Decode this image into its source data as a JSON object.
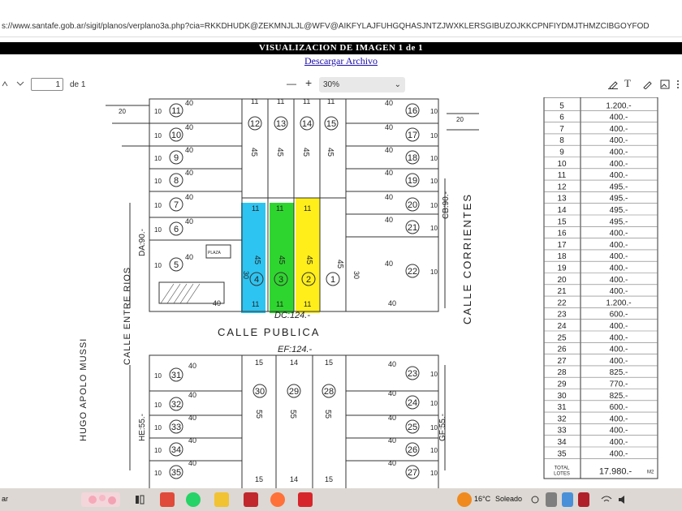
{
  "browser": {
    "url": "s://www.santafe.gob.ar/sigit/planos/verplano3a.php?cia=RKKDHUDK@ZEKMNJLJL@WFV@AIKFYLAJFUHGQHASJNTZJWXKLERSGIBUZOJKKCPNFIYDMJTHMZCIBGOYFOD"
  },
  "viewer": {
    "banner": "VISUALIZACION DE IMAGEN 1 de 1",
    "download_link": "Descargar Archivo",
    "page_number": "1",
    "page_of": "de 1",
    "zoom_minus": "—",
    "zoom_plus": "+",
    "zoom": "30%"
  },
  "plan": {
    "table_rows": [
      [
        "5",
        "1.200.-"
      ],
      [
        "6",
        "400.-"
      ],
      [
        "7",
        "400.-"
      ],
      [
        "8",
        "400.-"
      ],
      [
        "9",
        "400.-"
      ],
      [
        "10",
        "400.-"
      ],
      [
        "11",
        "400.-"
      ],
      [
        "12",
        "495.-"
      ],
      [
        "13",
        "495.-"
      ],
      [
        "14",
        "495.-"
      ],
      [
        "15",
        "495.-"
      ],
      [
        "16",
        "400.-"
      ],
      [
        "17",
        "400.-"
      ],
      [
        "18",
        "400.-"
      ],
      [
        "19",
        "400.-"
      ],
      [
        "20",
        "400.-"
      ],
      [
        "21",
        "400.-"
      ],
      [
        "22",
        "1.200.-"
      ],
      [
        "23",
        "600.-"
      ],
      [
        "24",
        "400.-"
      ],
      [
        "25",
        "400.-"
      ],
      [
        "26",
        "400.-"
      ],
      [
        "27",
        "400.-"
      ],
      [
        "28",
        "825.-"
      ],
      [
        "29",
        "770.-"
      ],
      [
        "30",
        "825.-"
      ],
      [
        "31",
        "600.-"
      ],
      [
        "32",
        "400.-"
      ],
      [
        "33",
        "400.-"
      ],
      [
        "34",
        "400.-"
      ],
      [
        "35",
        "400.-"
      ]
    ],
    "total_label_1": "TOTAL",
    "total_label_2": "LOTES",
    "total_value": "17.980.-",
    "total_unit": "M2",
    "streets": {
      "calle_publica": "CALLE PUBLICA",
      "calle_corrientes": "CALLE CORRIENTES",
      "calle_entre_rios": "CALLE ENTRE RIOS",
      "hugo_apolo_mussi": "HUGO APOLO MUSSI",
      "dc": "DC:124.-",
      "ef": "EF:124.-",
      "cb": "CB:90.-",
      "da": "DA:90.-",
      "he": "HE:55.-",
      "gf": "GF:55.-"
    },
    "upper_lots": [
      "11",
      "10",
      "9",
      "8",
      "7",
      "6",
      "5"
    ],
    "upper_right_lots": [
      "16",
      "17",
      "18",
      "19",
      "20",
      "21",
      "22"
    ],
    "top_mid_lots": [
      "12",
      "13",
      "14",
      "15"
    ],
    "highlighted_lots": [
      {
        "label": "4",
        "color": "#2ec4f1"
      },
      {
        "label": "3",
        "color": "#2fd52f"
      },
      {
        "label": "2",
        "color": "#ffee1a"
      }
    ],
    "lot_1": "1",
    "lower_left_lots": [
      "31",
      "32",
      "33",
      "34",
      "35"
    ],
    "lower_right_lots": [
      "23",
      "24",
      "25",
      "26",
      "27"
    ],
    "lower_mid_lots": [
      "30",
      "29",
      "28"
    ],
    "dim_40": "40",
    "dim_11": "11",
    "dim_45": "45",
    "dim_30": "30",
    "dim_15": "15",
    "dim_14": "14",
    "dim_55": "55",
    "dim_10": "10",
    "dim_20": "20",
    "plaza_label": "PLAZA"
  },
  "taskbar": {
    "start_text": "ar",
    "weather_temp": "16°C",
    "weather_text": "Soleado"
  }
}
